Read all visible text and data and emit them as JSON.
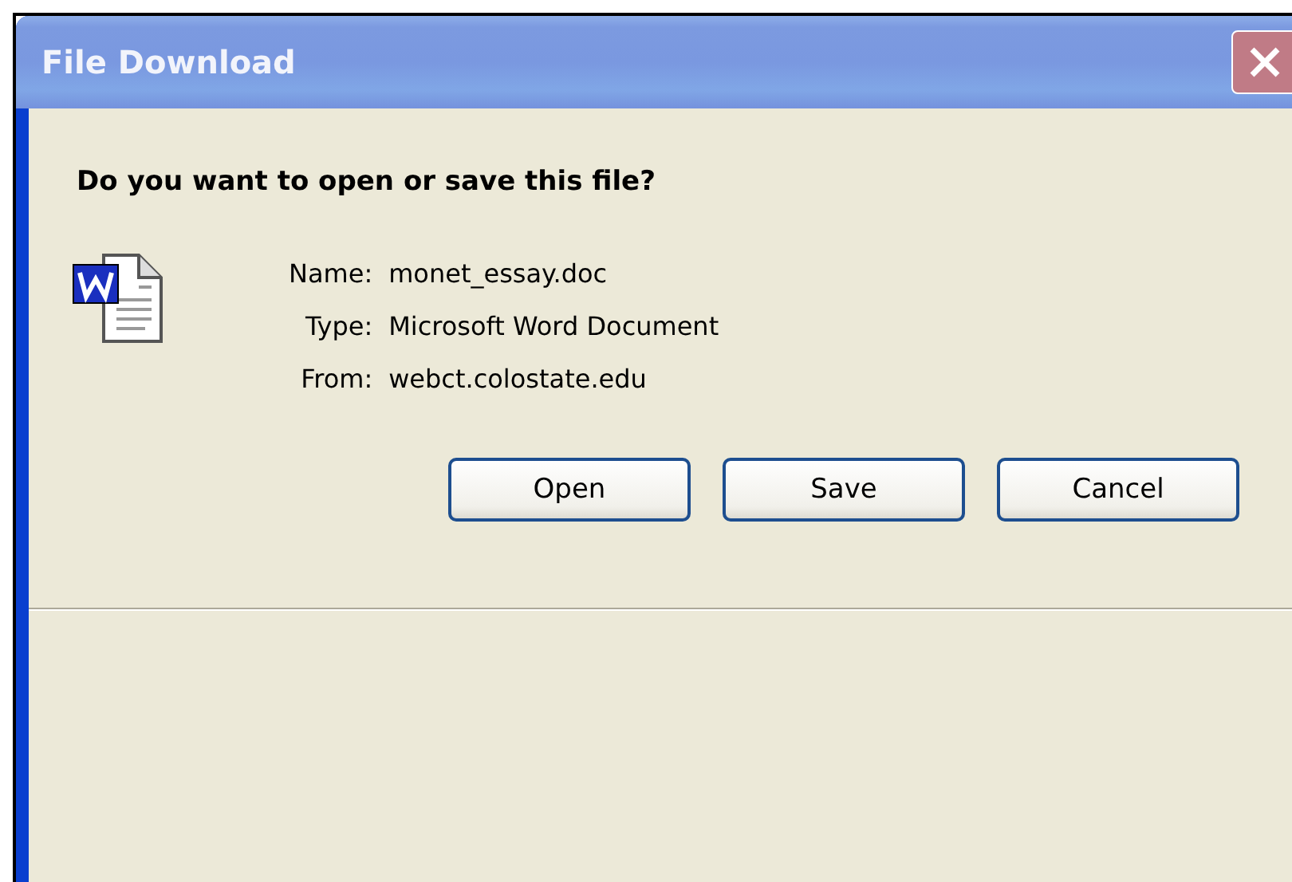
{
  "window": {
    "title": "File Download"
  },
  "question": "Do you want to open or save this file?",
  "fields": [
    {
      "label": "Name:",
      "value": "monet_essay.doc"
    },
    {
      "label": "Type:",
      "value": "Microsoft Word Document"
    },
    {
      "label": "From:",
      "value": "webct.colostate.edu"
    }
  ],
  "buttons": [
    "Open",
    "Save",
    "Cancel"
  ]
}
